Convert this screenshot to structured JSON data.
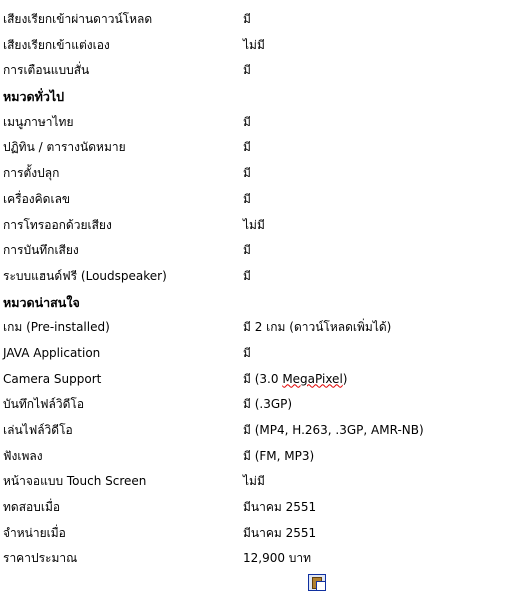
{
  "rows": [
    {
      "label": "เสียงเรียกเข้าผ่านดาวน์โหลด",
      "value": "มี"
    },
    {
      "label": "เสียงเรียกเข้าแต่งเอง",
      "value": "ไม่มี"
    },
    {
      "label": "การเตือนแบบสั่น",
      "value": "มี"
    },
    {
      "label": "หมวดทั่วไป",
      "header": true
    },
    {
      "label": "เมนูภาษาไทย",
      "value": "มี"
    },
    {
      "label": "ปฏิทิน / ตารางนัดหมาย",
      "value": "มี"
    },
    {
      "label": "การตั้งปลุก",
      "value": "มี"
    },
    {
      "label": "เครื่องคิดเลข",
      "value": "มี"
    },
    {
      "label": "การโทรออกด้วยเสียง",
      "value": "ไม่มี"
    },
    {
      "label": "การบันทึกเสียง",
      "value": "มี"
    },
    {
      "label": "ระบบแฮนด์ฟรี (Loudspeaker)",
      "value": "มี"
    },
    {
      "label": "หมวดน่าสนใจ",
      "header": true
    },
    {
      "label": "เกม (Pre-installed)",
      "value": "มี 2 เกม (ดาวน์โหลดเพิ่มได้)"
    },
    {
      "label": "JAVA Application",
      "value": "มี"
    },
    {
      "label": "Camera Support",
      "value": "มี (3.0 MegaPixel)"
    },
    {
      "label": "บันทึกไฟล์วิดีโอ",
      "value": "มี (.3GP)"
    },
    {
      "label": "เล่นไฟล์วิดีโอ",
      "value": "มี (MP4, H.263, .3GP, AMR-NB)"
    },
    {
      "label": "ฟังเพลง",
      "value": "มี (FM, MP3)"
    },
    {
      "label": "หน้าจอแบบ Touch Screen",
      "value": "ไม่มี"
    },
    {
      "label": "ทดสอบเมื่อ",
      "value": "มีนาคม 2551"
    },
    {
      "label": "จำหน่ายเมื่อ",
      "value": "มีนาคม 2551"
    },
    {
      "label": "ราคาประมาณ",
      "value": "12,900 บาท"
    }
  ],
  "icons": {
    "paste": "paste-clipboard-icon"
  }
}
